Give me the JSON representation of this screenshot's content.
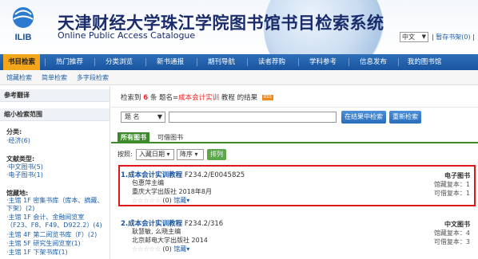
{
  "header": {
    "logo_text": "ILIB",
    "title_cn": "天津财经大学珠江学院图书馆书目检索系统",
    "title_en": "Online Public Access Catalogue",
    "lang": "中文",
    "links_sep": "|",
    "bookshelf": "暂存书架(0)",
    "bookshelf_sep": "|"
  },
  "nav": {
    "items": [
      "书目检索",
      "热门推荐",
      "分类浏览",
      "新书通报",
      "期刊导航",
      "读者荐购",
      "学科参考",
      "信息发布",
      "我的图书馆"
    ],
    "active_index": 0
  },
  "subnav": {
    "items": [
      "馆藏检索",
      "简单检索",
      "多字段检索"
    ]
  },
  "left": {
    "ref_title": "参考翻译",
    "narrow_title": "缩小检索范围",
    "facets": [
      {
        "title": "分类:",
        "items": [
          "·经济(6)"
        ]
      },
      {
        "title": "文献类型:",
        "items": [
          "·中文图书(5)",
          "·电子图书(1)"
        ]
      },
      {
        "title": "馆藏地:",
        "items": [
          "·主馆 1F 密集书库（库本、摘藏、下架）(2)",
          "·主馆 1F 会计、金融阅览室（F23、F8、F49、D922.2）(4)",
          "·主馆 4F 第二阅览书库（F）(2)",
          "·主馆 5F 研究生阅览室(1)",
          "·主馆 1F 下架书库(1)"
        ]
      }
    ]
  },
  "main": {
    "result": {
      "prefix": "检索到",
      "count": "6",
      "mid": "条 题名=",
      "keyword": "成本会计实训",
      "suffix": "教程 的结果",
      "rss": "RSS"
    },
    "search": {
      "field": "题 名",
      "btn_result": "在结果中检索",
      "btn_new": "重新检索"
    },
    "tabs": [
      "所有图书",
      "可借图书"
    ],
    "sort": {
      "label": "按照:",
      "field": "入藏日期",
      "order": "降序",
      "button": "排列"
    },
    "records": [
      {
        "title": "1.成本会计实训教程",
        "call": "F234.2/E0045825",
        "author": "包惠萍主编",
        "publisher": "重庆大学出版社 2018年8月",
        "stars": "☆☆☆☆☆",
        "rating_count": "(0)",
        "details": "馆藏",
        "type": "电子图书",
        "holdings": "馆藏复本：1",
        "available": "可借复本：1"
      },
      {
        "title": "2.成本会计实训教程",
        "call": "F234.2/316",
        "author": "耿慧敏, 么晓主编",
        "publisher": "北京邮电大学出版社 2014",
        "stars": "☆☆☆☆☆",
        "rating_count": "(0)",
        "details": "馆藏",
        "type": "中文图书",
        "holdings": "馆藏复本：4",
        "available": "可借复本：3"
      }
    ]
  },
  "colors": {
    "nav_bg": "#1a55a0",
    "nav_active": "#f3a619",
    "tab_green": "#3d8a2a",
    "highlight_red": "#e0161b"
  }
}
